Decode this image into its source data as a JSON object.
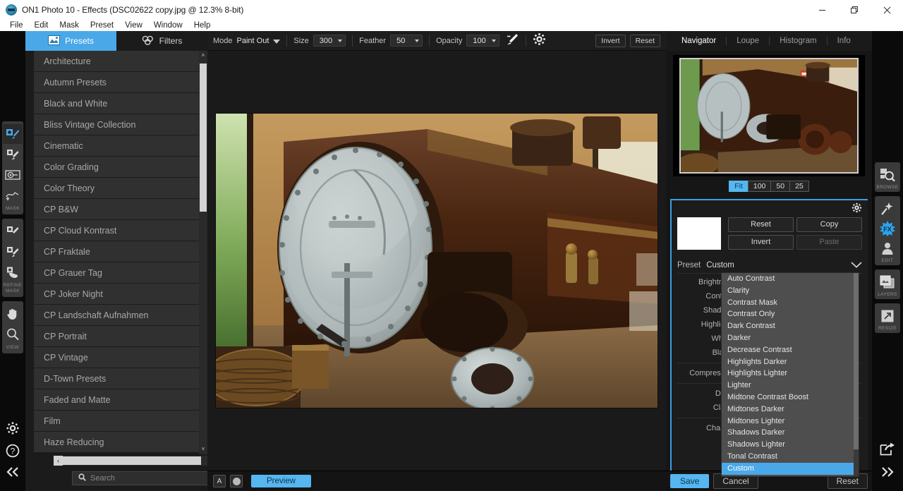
{
  "window": {
    "title": "ON1 Photo 10 - Effects (DSC02622 copy.jpg @ 12.3% 8-bit)",
    "app_icon": "on1-logo-icon",
    "minimize_label": "Minimize",
    "restore_label": "Restore",
    "close_label": "Close"
  },
  "menubar": {
    "items": [
      "File",
      "Edit",
      "Mask",
      "Preset",
      "View",
      "Window",
      "Help"
    ]
  },
  "left_rail": {
    "groups": [
      {
        "label": "MASK",
        "tools": [
          {
            "name": "masking-brush-tool",
            "selected": true
          },
          {
            "name": "perfect-brush-tool",
            "selected": false
          },
          {
            "name": "masking-bug-tool",
            "selected": false
          },
          {
            "name": "gradient-mask-tool",
            "selected": false
          }
        ]
      },
      {
        "label": "REFINE MASK",
        "tools": [
          {
            "name": "refine-brush-tool",
            "selected": false
          },
          {
            "name": "chisel-mask-tool",
            "selected": false
          },
          {
            "name": "blur-mask-tool",
            "selected": false
          }
        ]
      },
      {
        "label": "VIEW",
        "tools": [
          {
            "name": "pan-hand-tool",
            "selected": false
          },
          {
            "name": "zoom-tool",
            "selected": false
          }
        ]
      }
    ],
    "bottom": [
      {
        "name": "settings-gear-icon"
      },
      {
        "name": "help-question-icon"
      },
      {
        "name": "collapse-left-panel-icon"
      }
    ]
  },
  "left_panel": {
    "tabs": [
      {
        "label": "Presets",
        "icon": "presets-image-icon",
        "active": true
      },
      {
        "label": "Filters",
        "icon": "filters-circles-icon",
        "active": false
      }
    ],
    "presets": [
      "Architecture",
      "Autumn Presets",
      "Black and White",
      "Bliss Vintage Collection",
      "Cinematic",
      "Color Grading",
      "Color Theory",
      "CP B&W",
      "CP Cloud Kontrast",
      "CP Fraktale",
      "CP Grauer Tag",
      "CP Joker Night",
      "CP Landschaft Aufnahmen",
      "CP Portrait",
      "CP Vintage",
      "D-Town Presets",
      "Faded and Matte",
      "Film",
      "Haze Reducing"
    ],
    "search": {
      "placeholder": "Search",
      "value": "",
      "icon": "search-icon"
    },
    "scroll_up_glyph": "˄",
    "scroll_down_glyph": "˅",
    "scroll_left_glyph": "‹",
    "scroll_right_glyph": "›"
  },
  "toolbar": {
    "mode_label": "Mode",
    "mode_value": "Paint Out",
    "size_label": "Size",
    "size_value": "300",
    "feather_label": "Feather",
    "feather_value": "50",
    "opacity_label": "Opacity",
    "opacity_value": "100",
    "brush_icon": "paint-brush-icon",
    "settings_icon": "gear-icon",
    "invert_label": "Invert",
    "reset_label": "Reset"
  },
  "canvas": {
    "image_alt": "Steam locomotive in museum hall",
    "bottom": {
      "compare_label": "A",
      "soft_proof_icon": "circle-toggle-icon",
      "preview_label": "Preview"
    }
  },
  "right_panel": {
    "tabs": [
      {
        "label": "Navigator",
        "active": true
      },
      {
        "label": "Loupe",
        "active": false
      },
      {
        "label": "Histogram",
        "active": false
      },
      {
        "label": "Info",
        "active": false
      }
    ],
    "zoom_levels": [
      {
        "label": "Fit",
        "active": true
      },
      {
        "label": "100",
        "active": false
      },
      {
        "label": "50",
        "active": false
      },
      {
        "label": "25",
        "active": false
      }
    ],
    "filter": {
      "gear_icon": "filter-settings-gear-icon",
      "mask_swatch_color": "#ffffff",
      "buttons": [
        {
          "label": "Reset",
          "disabled": false
        },
        {
          "label": "Copy",
          "disabled": false
        },
        {
          "label": "Invert",
          "disabled": false
        },
        {
          "label": "Paste",
          "disabled": true
        }
      ],
      "preset_label": "Preset",
      "preset_value": "Custom",
      "sliders": [
        "Brightness",
        "Contrast",
        "Shadows",
        "Highlights",
        "Whites",
        "Blacks"
      ],
      "sliders_group2": [
        "Compression"
      ],
      "sliders_group3": [
        "Detail",
        "Clarity"
      ],
      "sliders_group4": [
        "Channel"
      ]
    },
    "dropdown": {
      "open": true,
      "items": [
        {
          "label": "Auto Contrast",
          "selected": false
        },
        {
          "label": "Clarity",
          "selected": false
        },
        {
          "label": "Contrast Mask",
          "selected": false
        },
        {
          "label": "Contrast Only",
          "selected": false
        },
        {
          "label": "Dark Contrast",
          "selected": false
        },
        {
          "label": "Darker",
          "selected": false
        },
        {
          "label": "Decrease Contrast",
          "selected": false
        },
        {
          "label": "Highlights Darker",
          "selected": false
        },
        {
          "label": "Highlights Lighter",
          "selected": false
        },
        {
          "label": "Lighter",
          "selected": false
        },
        {
          "label": "Midtone Contrast Boost",
          "selected": false
        },
        {
          "label": "Midtones Darker",
          "selected": false
        },
        {
          "label": "Midtones Lighter",
          "selected": false
        },
        {
          "label": "Shadows Darker",
          "selected": false
        },
        {
          "label": "Shadows Lighter",
          "selected": false
        },
        {
          "label": "Tonal Contrast",
          "selected": false
        },
        {
          "label": "Custom",
          "selected": true
        }
      ]
    },
    "bottom": {
      "save_label": "Save",
      "cancel_label": "Cancel",
      "reset_label": "Reset"
    }
  },
  "right_rail": {
    "groups": [
      {
        "label": "BROWSE",
        "tools": [
          {
            "name": "browse-icon",
            "selected": false
          }
        ]
      },
      {
        "label": "EDIT",
        "tools": [
          {
            "name": "enhance-wand-icon",
            "selected": false
          },
          {
            "name": "effects-fx-icon",
            "selected": true
          },
          {
            "name": "portrait-icon",
            "selected": false
          }
        ]
      },
      {
        "label": "LAYERS",
        "tools": [
          {
            "name": "layers-icon",
            "selected": false
          }
        ]
      },
      {
        "label": "RESIZE",
        "tools": [
          {
            "name": "resize-icon",
            "selected": false
          }
        ]
      }
    ],
    "bottom": [
      {
        "name": "share-export-icon"
      },
      {
        "name": "expand-right-panel-icon"
      }
    ]
  },
  "colors": {
    "accent_blue": "#55b6f0",
    "panel_bg": "#1b1b1b",
    "preset_row_bg": "#303030",
    "highlight_border": "#3c9fe0"
  }
}
